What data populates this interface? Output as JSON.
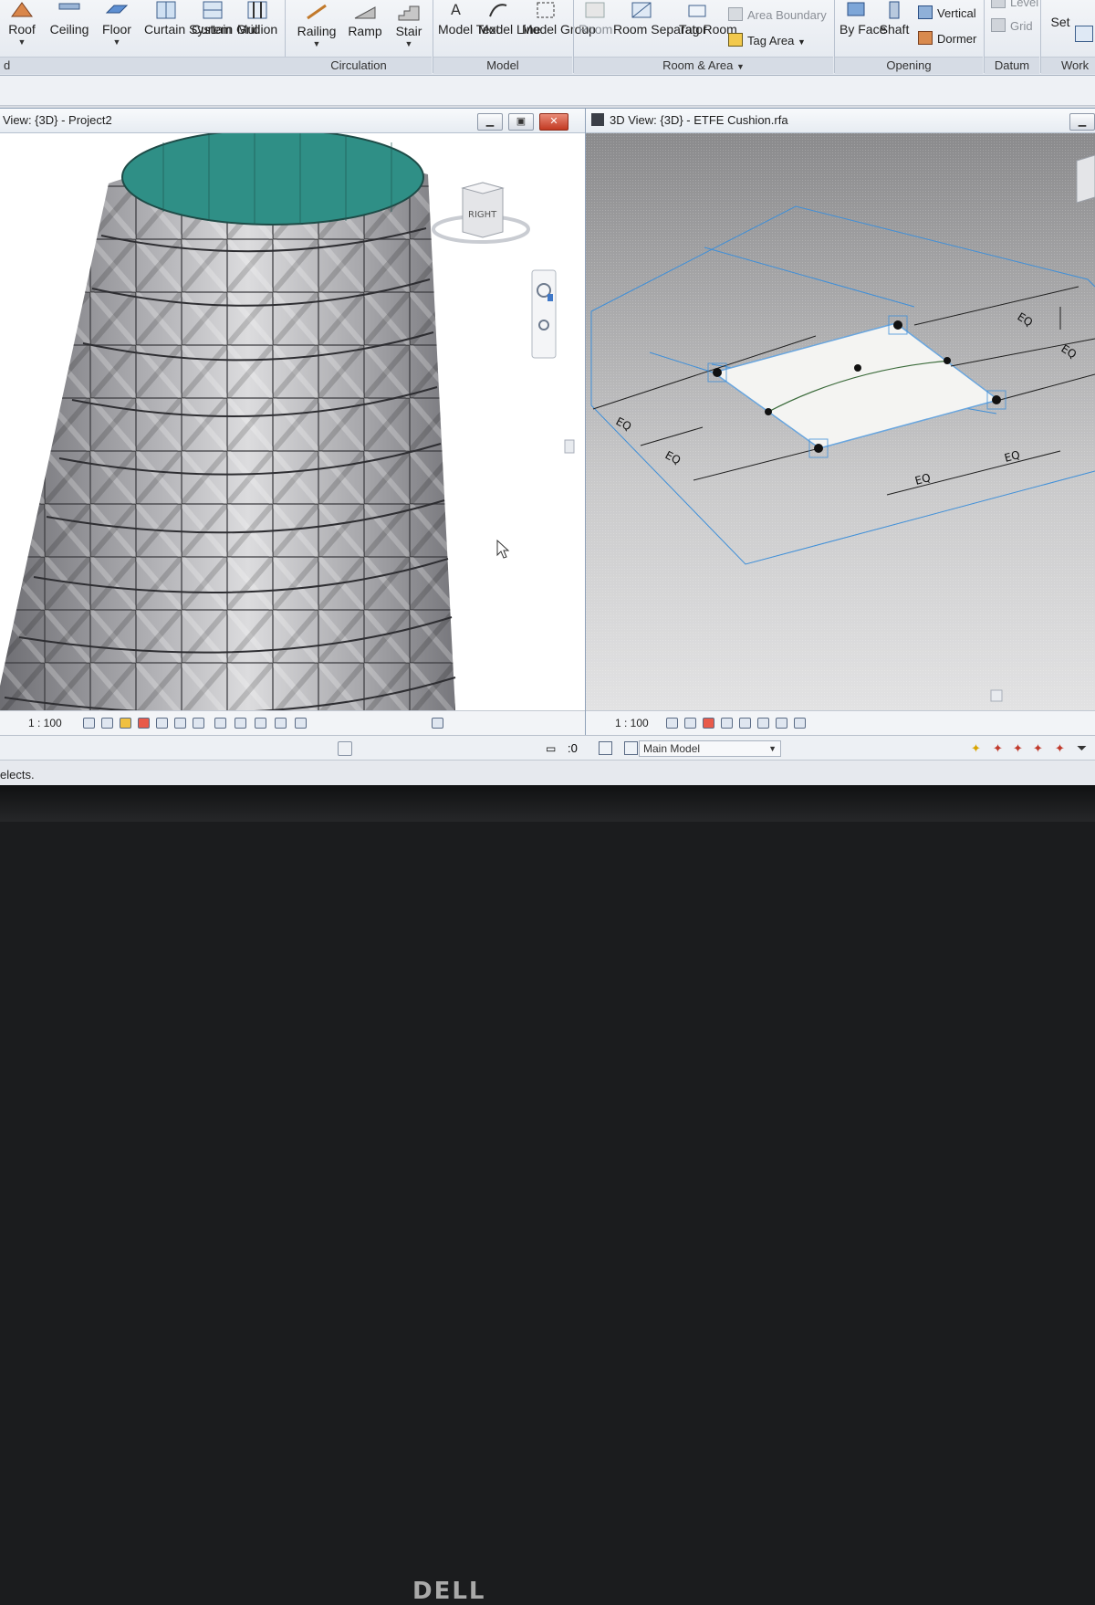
{
  "ribbon": {
    "buttons": [
      {
        "label": "Roof",
        "has_caret": true
      },
      {
        "label": "Ceiling",
        "has_caret": false
      },
      {
        "label": "Floor",
        "has_caret": true
      },
      {
        "label": "Curtain System",
        "has_caret": false
      },
      {
        "label": "Curtain Grid",
        "has_caret": false
      },
      {
        "label": "Mullion",
        "has_caret": false
      },
      {
        "label": "Railing",
        "has_caret": true
      },
      {
        "label": "Ramp",
        "has_caret": false
      },
      {
        "label": "Stair",
        "has_caret": true
      },
      {
        "label": "Model Text",
        "has_caret": false
      },
      {
        "label": "Model Line",
        "has_caret": false
      },
      {
        "label": "Model Group",
        "has_caret": true
      },
      {
        "label": "Room",
        "has_caret": false
      },
      {
        "label": "Room Separator",
        "has_caret": false
      },
      {
        "label": "Tag Room",
        "has_caret": true
      },
      {
        "label": "By Face",
        "has_caret": false
      },
      {
        "label": "Shaft",
        "has_caret": false
      },
      {
        "label": "Set",
        "has_caret": false
      }
    ],
    "small_buttons": {
      "area_boundary": "Area Boundary",
      "tag_area": "Tag Area",
      "vertical": "Vertical",
      "dormer": "Dormer",
      "level": "Level",
      "grid": "Grid"
    },
    "panels": {
      "build_tail": "d",
      "circulation": "Circulation",
      "model": "Model",
      "room_area": "Room & Area",
      "opening": "Opening",
      "datum": "Datum",
      "work_plane": "Work"
    }
  },
  "left_view": {
    "title": "View: {3D} - Project2",
    "scale": "1 : 100",
    "viewcube_face": "RIGHT"
  },
  "right_view": {
    "title": "3D View: {3D} - ETFE Cushion.rfa",
    "scale": "1 : 100",
    "dimension_label": "EQ"
  },
  "bottom_bar": {
    "zero_label": ":0",
    "model_select": "Main Model"
  },
  "statusline": {
    "text": "elects."
  },
  "monitor": {
    "brand": "DELL"
  },
  "colors": {
    "ribbon_bg": "#e9edf2",
    "selection_blue": "#3f8fd8",
    "cushion_surface": "#f4f4f2",
    "tower_gray": "#8d8d92",
    "tower_top_teal": "#2f8f86"
  }
}
